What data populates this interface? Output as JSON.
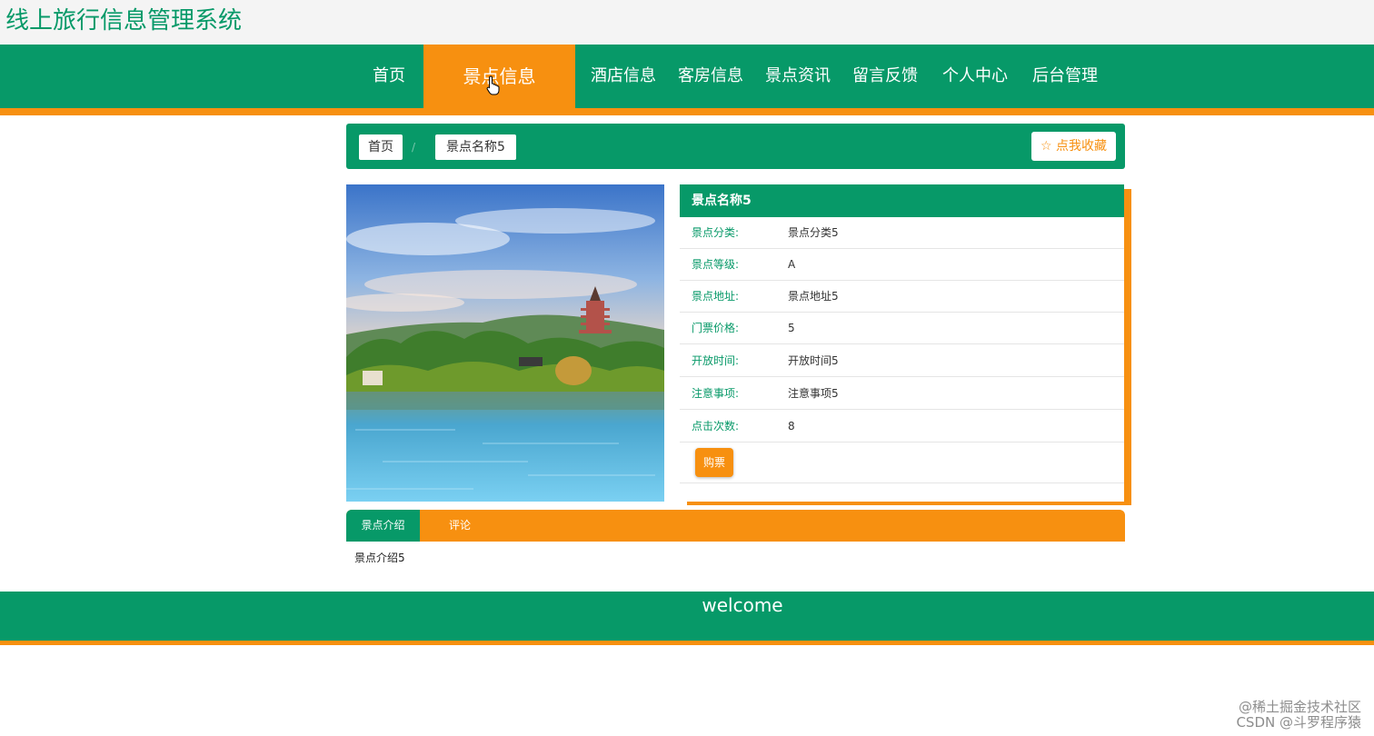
{
  "header": {
    "site_title": "线上旅行信息管理系统"
  },
  "nav": {
    "items": [
      {
        "label": "首页"
      },
      {
        "label": "景点信息",
        "active": true
      },
      {
        "label": "酒店信息"
      },
      {
        "label": "客房信息"
      },
      {
        "label": "景点资讯"
      },
      {
        "label": "留言反馈"
      },
      {
        "label": "个人中心"
      },
      {
        "label": "后台管理"
      }
    ]
  },
  "breadcrumb": {
    "home": "首页",
    "separator": "/",
    "current": "景点名称5"
  },
  "favorite": {
    "label": "点我收藏",
    "icon": "star-outline-icon"
  },
  "detail": {
    "title": "景点名称5",
    "rows": [
      {
        "label": "景点分类:",
        "value": "景点分类5"
      },
      {
        "label": "景点等级:",
        "value": "A"
      },
      {
        "label": "景点地址:",
        "value": "景点地址5"
      },
      {
        "label": "门票价格:",
        "value": "5"
      },
      {
        "label": "开放时间:",
        "value": "开放时间5"
      },
      {
        "label": "注意事项:",
        "value": "注意事项5"
      },
      {
        "label": "点击次数:",
        "value": "8"
      }
    ],
    "buy_label": "购票"
  },
  "tabs": {
    "items": [
      {
        "label": "景点介绍",
        "active": true
      },
      {
        "label": "评论"
      }
    ]
  },
  "intro": {
    "text": "景点介绍5"
  },
  "footer": {
    "welcome": "welcome"
  },
  "watermarks": {
    "line1": "@稀土掘金技术社区",
    "line2": "CSDN @斗罗程序猿"
  },
  "colors": {
    "primary": "#079968",
    "accent": "#f79010"
  }
}
